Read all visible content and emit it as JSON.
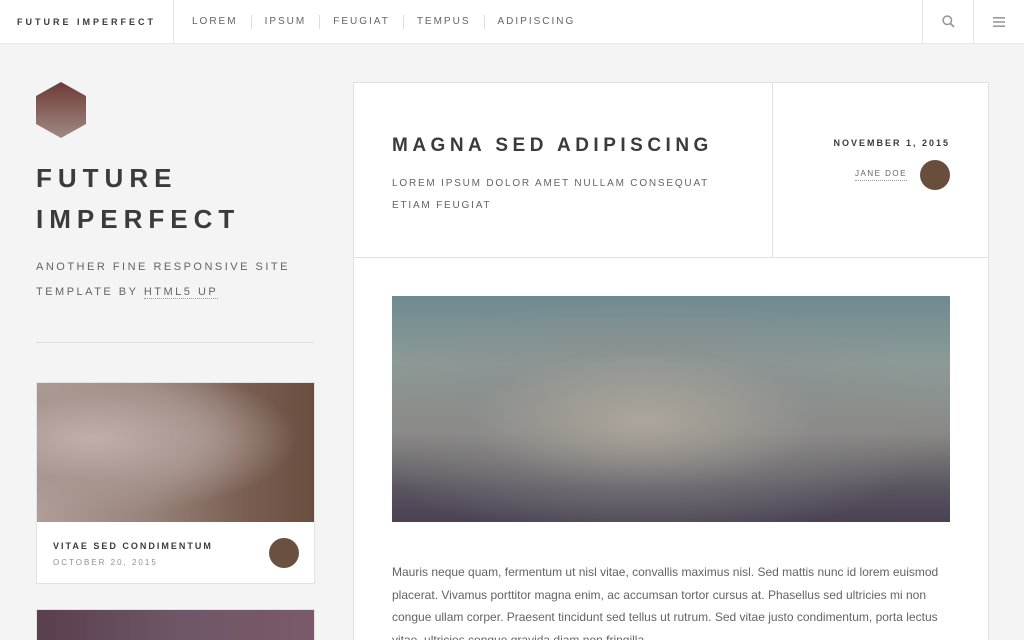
{
  "header": {
    "brand": "FUTURE IMPERFECT",
    "nav": [
      "LOREM",
      "IPSUM",
      "FEUGIAT",
      "TEMPUS",
      "ADIPISCING"
    ],
    "search_icon": "search-icon",
    "menu_icon": "menu-icon"
  },
  "intro": {
    "logo_icon": "hexagon-logo-icon",
    "title_line1": "FUTURE",
    "title_line2": "IMPERFECT",
    "subtitle_text": "ANOTHER FINE RESPONSIVE SITE TEMPLATE BY ",
    "subtitle_link": "HTML5 UP"
  },
  "mini_posts": [
    {
      "title": "VITAE SED CONDIMENTUM",
      "date": "OCTOBER 20, 2015"
    }
  ],
  "post": {
    "title": "MAGNA SED ADIPISCING",
    "subtitle": "LOREM IPSUM DOLOR AMET NULLAM CONSEQUAT ETIAM FEUGIAT",
    "date": "NOVEMBER 1, 2015",
    "author": "JANE DOE",
    "body": "Mauris neque quam, fermentum ut nisl vitae, convallis maximus nisl. Sed mattis nunc id lorem euismod placerat. Vivamus porttitor magna enim, ac accumsan tortor cursus at. Phasellus sed ultricies mi non congue ullam corper. Praesent tincidunt sed tellus ut rutrum. Sed vitae justo condimentum, porta lectus vitae, ultricies congue gravida diam non fringilla."
  },
  "colors": {
    "background": "#f4f4f4",
    "card": "#ffffff",
    "heading": "#3c3b3b",
    "text": "#646464",
    "border": "#e2e2e2"
  }
}
